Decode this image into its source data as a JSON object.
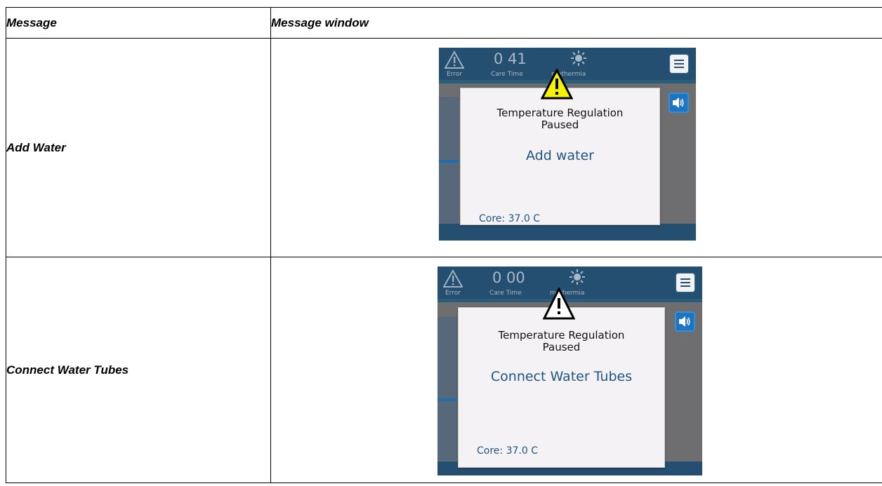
{
  "table": {
    "header": {
      "col1": "Message",
      "col2": "Message window"
    },
    "rows": [
      {
        "label": "Add Water",
        "screen": {
          "status": {
            "error_label": "Error",
            "time_value": "0 41",
            "time_label": "Care Time",
            "mode_label": "mothermia"
          },
          "dialog": {
            "title_line1": "Temperature Regulation",
            "title_line2": "Paused",
            "message": "Add water",
            "core": "Core: 37.0 C"
          },
          "warning_icon_color": "#f5f200"
        }
      },
      {
        "label": "Connect Water Tubes",
        "screen": {
          "status": {
            "error_label": "Error",
            "time_value": "0 00",
            "time_label": "Care Time",
            "mode_label": "mothermia"
          },
          "dialog": {
            "title_line1": "Temperature Regulation",
            "title_line2": "Paused",
            "message": "Connect Water Tubes",
            "core": "Core: 37.0 C"
          },
          "warning_icon_color": "#ffffff"
        }
      }
    ]
  },
  "colors": {
    "topbar": "#244f70",
    "screen_bg": "#6e6e70",
    "dialog_bg": "#f5f2f5",
    "accent_text": "#1c5586",
    "sound_button": "#1c74c2"
  },
  "icons": [
    "warning-triangle-icon",
    "error-triangle-icon",
    "sun-icon",
    "menu-icon",
    "speaker-icon"
  ]
}
